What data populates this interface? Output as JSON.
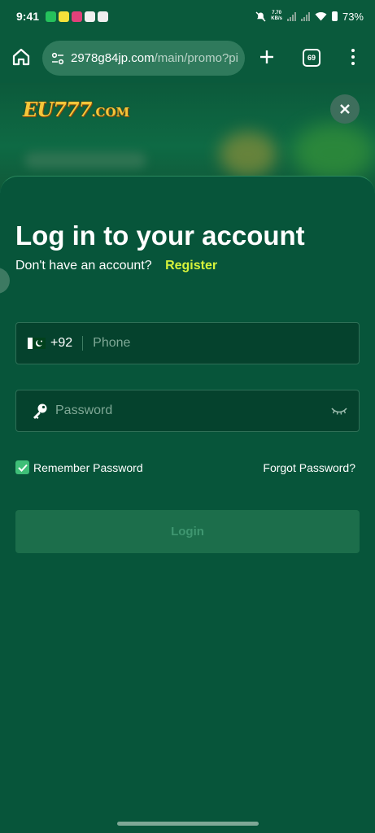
{
  "status_bar": {
    "time": "9:41",
    "speed_value": "7.70",
    "speed_unit": "KB/s",
    "battery": "73%",
    "notif_icons": [
      "whatsapp-icon",
      "snapchat-icon",
      "messenger-icon",
      "chrome-icon",
      "play-store-icon"
    ]
  },
  "browser": {
    "url_host": "2978g84jp.com",
    "url_path": "/main/promo?pi",
    "tab_count": "69"
  },
  "banner": {
    "logo_main": "EU777",
    "logo_suffix": ".COM"
  },
  "login": {
    "title": "Log in to your account",
    "register_prompt": "Don't have an account?",
    "register_link": "Register",
    "country_code": "+92",
    "phone_placeholder": "Phone",
    "password_placeholder": "Password",
    "remember_label": "Remember Password",
    "remember_checked": true,
    "forgot_label": "Forgot Password?",
    "login_label": "Login"
  },
  "colors": {
    "background": "#07553a",
    "accent_link": "#d6f23b",
    "checkbox": "#3fbf78"
  }
}
